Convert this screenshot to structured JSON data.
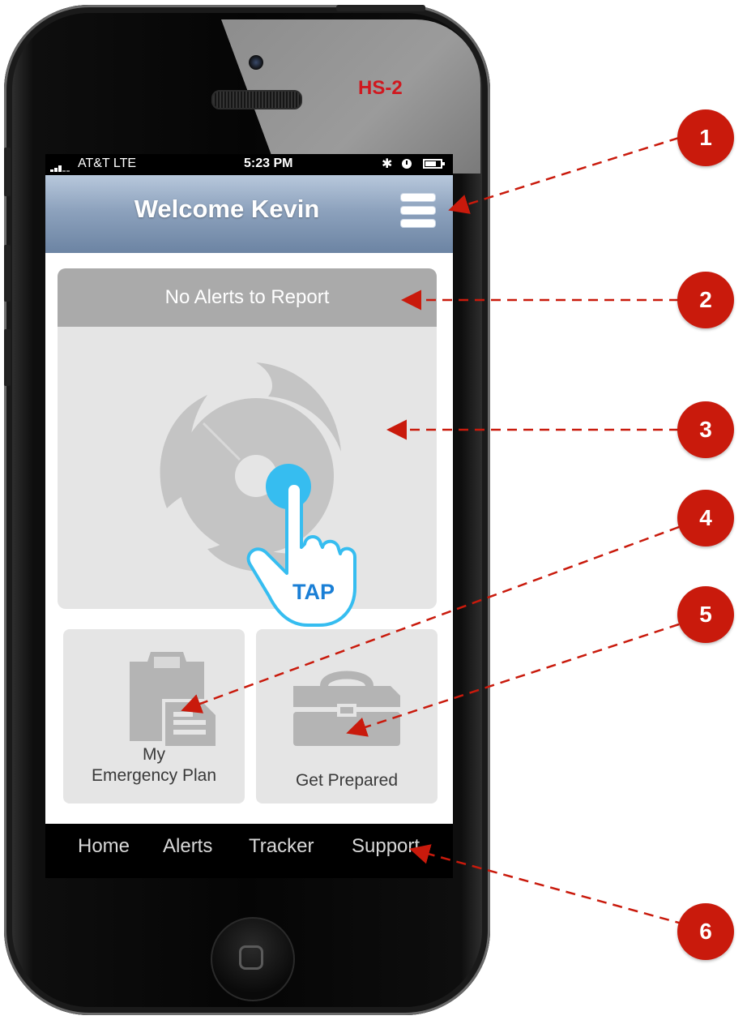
{
  "screen_id": "HS-2",
  "status_bar": {
    "carrier": "AT&T LTE",
    "time": "5:23 PM",
    "battery_level": 0.7
  },
  "header": {
    "title": "Welcome Kevin",
    "menu_icon": "hamburger-menu-icon"
  },
  "alerts": {
    "message": "No Alerts to Report",
    "icon": "hurricane-icon"
  },
  "gesture": {
    "label": "TAP",
    "icon": "tap-hand-icon",
    "color": "#36bdf0"
  },
  "tiles": [
    {
      "label_line1": "My",
      "label_line2": "Emergency Plan",
      "icon": "clipboard-document-icon"
    },
    {
      "label": "Get Prepared",
      "icon": "toolbox-icon"
    }
  ],
  "tab_bar": {
    "items": [
      "Home",
      "Alerts",
      "Tracker",
      "Support"
    ]
  },
  "callouts": [
    "1",
    "2",
    "3",
    "4",
    "5",
    "6"
  ],
  "colors": {
    "callout_red": "#c91a0c",
    "header_blue": "#8da2bd",
    "label_red": "#d0181f"
  }
}
